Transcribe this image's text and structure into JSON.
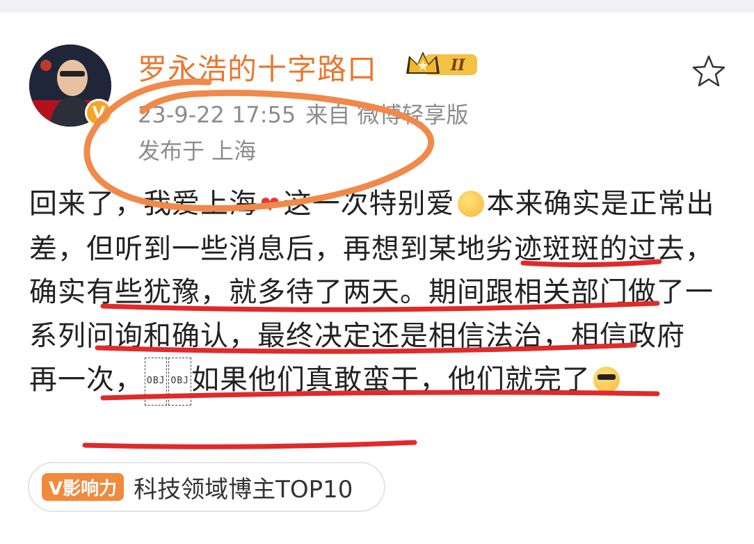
{
  "post": {
    "username": "罗永浩的十字路口",
    "level_badge": "II",
    "avatar_caption": "罗永浩\n的十字路口",
    "verified_badge": "V",
    "timestamp": "23-9-22 17:55",
    "source": "来自 微博轻享版",
    "location": "发布于 上海",
    "text": {
      "p1": "回来了，我爱上海",
      "p2": "这一次特别爱",
      "p3": "本来确实是正常出差，但听到一些消息后，再想到某地劣迹斑斑的过去，确实有些犹豫，就多待了两天。期间跟相关部门做了一系列问询和确认，最终决定还是相信法治，相信政府　再一次，",
      "obj1": "OBJ",
      "obj2": "OBJ",
      "p4": "如果他们真敢蛮干，他们就完了"
    }
  },
  "influence": {
    "badge": "V影响力",
    "label": "科技领域博主TOP10"
  },
  "colors": {
    "username": "#e8772e",
    "annotation": "#f0894a",
    "underline": "#e02a2a",
    "meta": "#8c8c8c"
  }
}
